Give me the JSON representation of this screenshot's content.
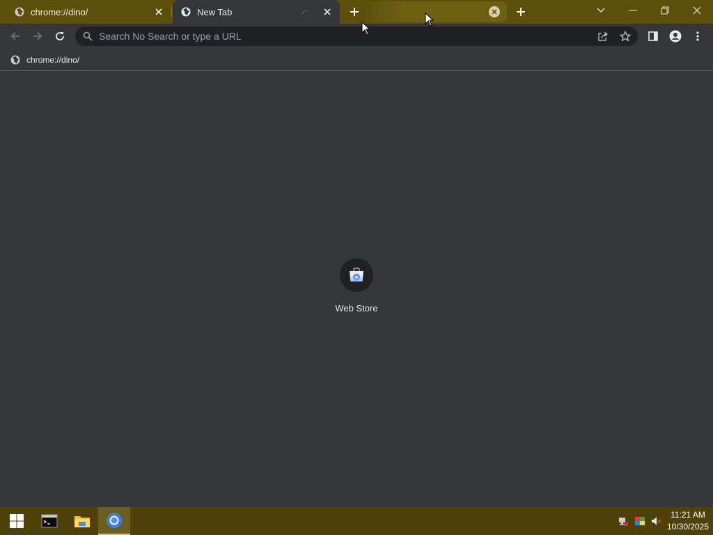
{
  "tabs": [
    {
      "title": "chrome://dino/",
      "icon": "globe-icon"
    },
    {
      "title": "New Tab",
      "icon": "globe-icon"
    }
  ],
  "toolbar": {
    "omnibox_placeholder": "Search No Search or type a URL"
  },
  "bookmarks": [
    {
      "label": "chrome://dino/",
      "icon": "globe-icon"
    }
  ],
  "shortcuts": [
    {
      "label": "Web Store",
      "icon": "web-store-icon"
    }
  ],
  "taskbar": {
    "time": "11:21 AM",
    "date": "10/30/2025",
    "apps": [
      "start-icon",
      "terminal-icon",
      "file-explorer-icon",
      "chrome-icon"
    ],
    "active_app": "chrome-icon"
  },
  "colors": {
    "titlebar": "#5c4f0b",
    "taskbar": "#4e420a",
    "page_background": "#35363a",
    "omnibox": "#202124"
  }
}
